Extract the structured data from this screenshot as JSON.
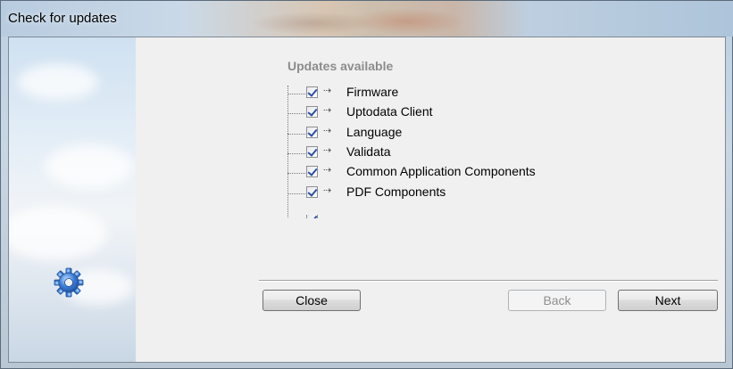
{
  "window": {
    "title": "Check for updates"
  },
  "main": {
    "heading": "Updates available",
    "items": [
      {
        "label": "Firmware",
        "checked": true
      },
      {
        "label": "Uptodata Client",
        "checked": true
      },
      {
        "label": "Language",
        "checked": true
      },
      {
        "label": "Validata",
        "checked": true
      },
      {
        "label": "Common Application Components",
        "checked": true
      },
      {
        "label": "PDF Components",
        "checked": true
      }
    ],
    "arrow_glyph": "⇢"
  },
  "icons": {
    "gear": "gear-icon",
    "scroll_up": "scroll-up-arrow-icon",
    "scroll_down": "scroll-down-arrow-icon"
  },
  "buttons": {
    "close": "Close",
    "back": "Back",
    "next": "Next"
  },
  "colors": {
    "heading": "#8c8c8c",
    "checkmark": "#2a4fa3",
    "gear": "#3a7bd5"
  }
}
